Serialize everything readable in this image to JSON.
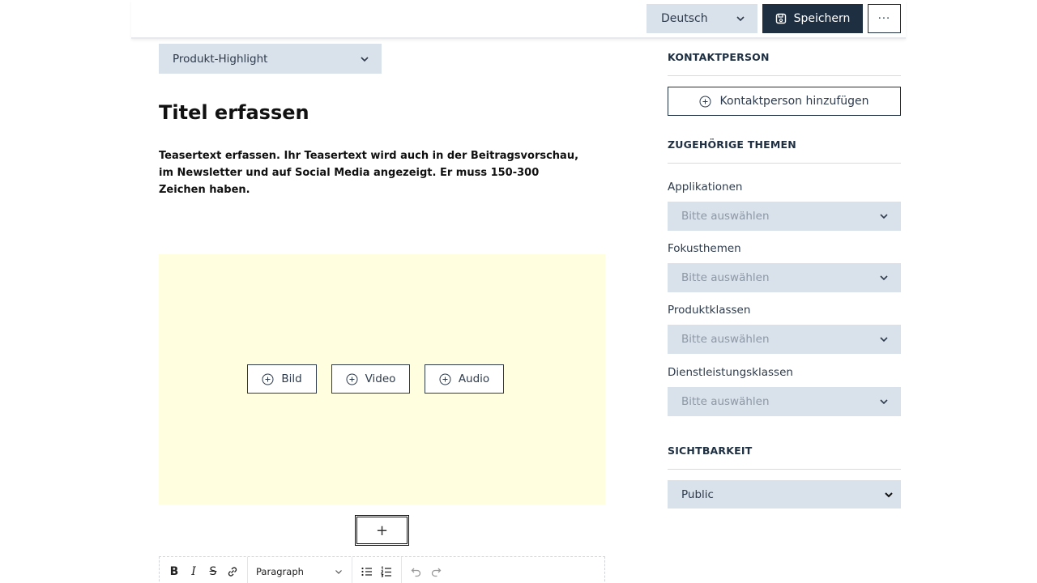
{
  "header": {
    "language": "Deutsch",
    "save_label": "Speichern",
    "more_label": "···"
  },
  "editor": {
    "type_select": "Produkt-Highlight",
    "title_placeholder": "Titel erfassen",
    "teaser_placeholder": "Teasertext erfassen. Ihr Teasertext wird auch in der Beitragsvorschau, im Newsletter und auf Social Media angezeigt. Er muss 150-300 Zeichen haben.",
    "media_buttons": [
      "Bild",
      "Video",
      "Audio"
    ],
    "add_block_label": "+",
    "toolbar": {
      "paragraph_select": "Paragraph",
      "icons": [
        "bold-icon",
        "italic-icon",
        "strikethrough-icon",
        "link-icon",
        "bullet-list-icon",
        "numbered-list-icon",
        "undo-icon",
        "redo-icon"
      ]
    }
  },
  "sidebar": {
    "contact": {
      "heading": "KONTAKTPERSON",
      "add_label": "Kontaktperson hinzufügen"
    },
    "topics": {
      "heading": "ZUGEHÖRIGE THEMEN",
      "fields": [
        {
          "label": "Applikationen",
          "placeholder": "Bitte auswählen"
        },
        {
          "label": "Fokusthemen",
          "placeholder": "Bitte auswählen"
        },
        {
          "label": "Produktklassen",
          "placeholder": "Bitte auswählen"
        },
        {
          "label": "Dienstleistungsklassen",
          "placeholder": "Bitte auswählen"
        }
      ]
    },
    "visibility": {
      "heading": "SICHTBARKEIT",
      "value": "Public"
    }
  },
  "colors": {
    "primary_dark": "#1e2f42",
    "select_bg": "#d9e1ea",
    "media_bg": "#ffffe0"
  }
}
